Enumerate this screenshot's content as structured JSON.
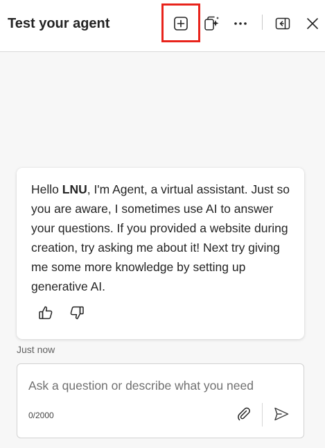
{
  "header": {
    "title": "Test your agent",
    "icons": [
      "new-chat-icon",
      "copilot-sparkle-icon",
      "more-icon",
      "collapse-panel-icon",
      "close-icon"
    ],
    "highlight_color": "#e8231b"
  },
  "message": {
    "greeting": "Hello ",
    "user_name": "LNU",
    "text": ", I'm Agent, a virtual assistant. Just so you are aware, I sometimes use AI to answer your questions. If you provided a website during creation, try asking me about it! Next try giving me some more knowledge by setting up generative AI.",
    "timestamp": "Just now",
    "reactions": [
      "thumbs-up-icon",
      "thumbs-down-icon"
    ]
  },
  "composer": {
    "placeholder": "Ask a question or describe what you need",
    "value": "",
    "counter": "0/2000",
    "icons": [
      "attach-icon",
      "send-icon"
    ]
  }
}
